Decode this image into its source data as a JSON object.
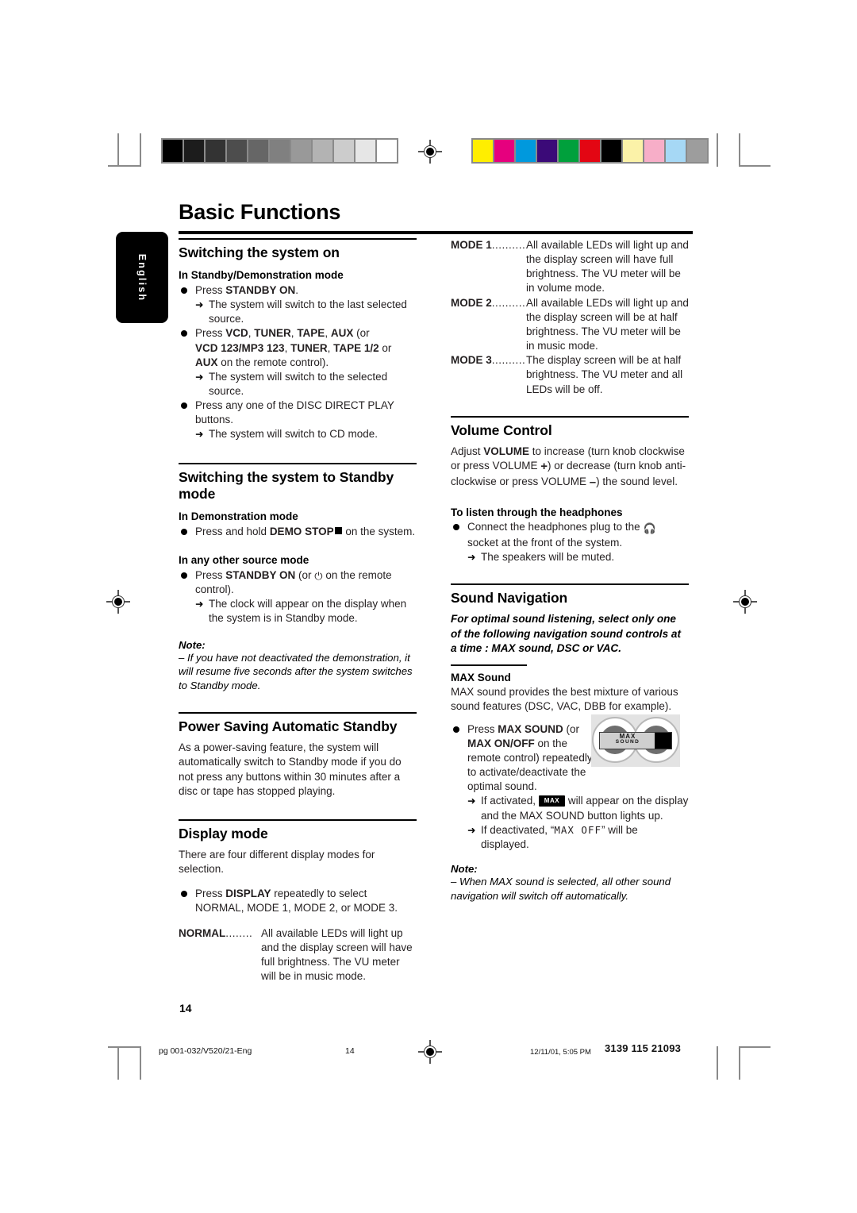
{
  "document": {
    "title": "Basic Functions",
    "language_tab": "English",
    "page_number": "14"
  },
  "calibration": {
    "grayscale_label": "grayscale-calibration-bar",
    "grayscale_swatches": [
      "#000000",
      "#1c1c1c",
      "#333333",
      "#4d4d4d",
      "#666666",
      "#808080",
      "#999999",
      "#b3b3b3",
      "#cccccc",
      "#e6e6e6",
      "#ffffff"
    ],
    "color_label": "color-calibration-bar",
    "color_swatches": [
      "#ffee00",
      "#e6007e",
      "#0099dd",
      "#3b0a78",
      "#00a03c",
      "#e30613",
      "#000000",
      "#fbf2a8",
      "#f7aec8",
      "#a6d8f5",
      "#9d9d9d"
    ]
  },
  "left_column": {
    "section1": {
      "heading": "Switching the system on",
      "sub1": "In Standby/Demonstration mode",
      "b1_pre": "Press ",
      "b1_bold": "STANDBY ON",
      "b1_post": ".",
      "b1_arrow": "The system will switch to the last selected source.",
      "b2_pre": "Press ",
      "b2_bold1": "VCD",
      "b2_sep1": ", ",
      "b2_bold2": "TUNER",
      "b2_sep2": ", ",
      "b2_bold3": "TAPE",
      "b2_sep3": ", ",
      "b2_bold4": "AUX",
      "b2_mid": " (or",
      "b2_line2_bold1": "VCD 123/MP3 123",
      "b2_line2_sep1": ", ",
      "b2_line2_bold2": "TUNER",
      "b2_line2_sep2": ", ",
      "b2_line2_bold3": "TAPE 1/2",
      "b2_line2_post": " or",
      "b2_line3_bold": "AUX",
      "b2_line3_post": " on the remote control).",
      "b2_arrow": "The system will switch to the selected source.",
      "b3_text": "Press any one of the DISC DIRECT PLAY buttons.",
      "b3_arrow": "The system will switch to CD mode."
    },
    "section2": {
      "heading": "Switching the system to Standby mode",
      "sub1": "In Demonstration mode",
      "b1_pre": "Press and hold ",
      "b1_bold": "DEMO STOP",
      "b1_post": " on the system.",
      "sub2": "In any other source mode",
      "b2_pre": "Press ",
      "b2_bold": "STANDBY ON",
      "b2_mid": " (or",
      "b2_post": " on the remote control).",
      "b2_arrow": "The clock will appear on the display when the system is in Standby mode.",
      "note_label": "Note:",
      "note_text": "–  If you have not deactivated the demonstration, it will resume five seconds after the system switches to Standby mode."
    },
    "section3": {
      "heading": "Power Saving Automatic Standby",
      "body": "As a power-saving feature, the system will automatically switch to Standby mode if you do not press any buttons within 30 minutes after a disc or tape has stopped playing."
    },
    "section4": {
      "heading": "Display mode",
      "body": "There are four different display modes for selection.",
      "bullet_pre": "Press ",
      "bullet_bold": "DISPLAY",
      "bullet_post": " repeatedly to select NORMAL, MODE 1, MODE 2, or MODE 3.",
      "def_term": "NORMAL",
      "def_leader": "........",
      "def_text": "All available LEDs will light up and the display screen will have full brightness. The VU meter will be in music mode."
    }
  },
  "right_column": {
    "modes": [
      {
        "term": "MODE 1",
        "leader": "..........",
        "text": "All available LEDs will light up and the display screen will have full brightness. The VU meter will be in volume mode."
      },
      {
        "term": "MODE 2",
        "leader": "..........",
        "text": "All available LEDs will light up and the display screen will be at half brightness. The VU meter will be in music mode."
      },
      {
        "term": "MODE 3",
        "leader": "..........",
        "text": "The display screen will be at half brightness. The VU meter and all LEDs will be off."
      }
    ],
    "volume": {
      "heading": "Volume Control",
      "p_pre": "Adjust ",
      "p_bold": "VOLUME",
      "p_mid1": " to increase (turn knob clockwise or press VOLUME ",
      "p_plus": "+",
      "p_mid2": ") or decrease (turn knob anti-clockwise or press VOLUME ",
      "p_minus": "–",
      "p_end": ") the sound level.",
      "sub": "To listen through the headphones",
      "hp_pre": "Connect the headphones plug to the ",
      "hp_post": " socket at the front of the system.",
      "hp_arrow": "The speakers will be muted."
    },
    "sound_nav": {
      "heading": "Sound Navigation",
      "intro": "For optimal sound listening, select only one of the following navigation sound controls at a time : MAX sound, DSC or VAC.",
      "sub": "MAX Sound",
      "body": "MAX sound provides the best mixture of various sound features (DSC, VAC, DBB for example).",
      "b_pre": "Press ",
      "b_bold1": "MAX SOUND",
      "b_mid": " (or ",
      "b_bold2": "MAX ON/OFF",
      "b_post": " on the remote control) repeatedly to activate/deactivate the optimal sound.",
      "arrow1_pre": "If activated, ",
      "arrow1_badge": "MAX",
      "arrow1_post": " will appear on the display and the MAX SOUND button lights up.",
      "arrow2_pre": "If deactivated, “",
      "arrow2_lcd": "MAX  OFF",
      "arrow2_post": "” will be displayed.",
      "note_label": "Note:",
      "note_text": "–  When MAX sound is selected, all other sound navigation will switch off automatically.",
      "image_label": "MAX SOUND",
      "image_label_line1": "MAX",
      "image_label_line2": "SOUND"
    }
  },
  "footer": {
    "file": "pg 001-032/V520/21-Eng",
    "page": "14",
    "date": "12/11/01, 5:05 PM",
    "code": "3139 115 21093"
  }
}
